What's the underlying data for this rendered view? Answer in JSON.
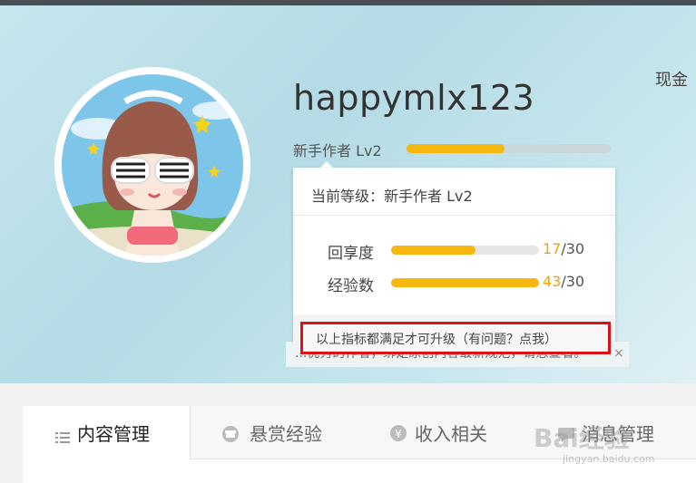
{
  "header": {
    "username": "happymlx123",
    "level_label": "新手作者 Lv2",
    "level_progress": 0.48,
    "cash_label": "现金"
  },
  "level_popup": {
    "title": "当前等级：新手作者 Lv2",
    "metrics": [
      {
        "label": "回享度",
        "current": "17",
        "max": "/30",
        "progress": 0.57
      },
      {
        "label": "经验数",
        "current": "43",
        "max": "/30",
        "progress": 1.0
      }
    ],
    "note": "以上指标都满足才可升级（有问题？点我）"
  },
  "notice": {
    "text": "...优秀的作者，绑定原创内容最新规范，请悉查看。",
    "close": "×"
  },
  "tabs": [
    {
      "label": "内容管理",
      "icon": "list-icon",
      "active": true
    },
    {
      "label": "悬赏经验",
      "icon": "reward-icon",
      "active": false
    },
    {
      "label": "收入相关",
      "icon": "yen-icon",
      "active": false
    },
    {
      "label": "消息管理",
      "icon": "message-icon",
      "active": false
    }
  ],
  "watermark": {
    "text": "Bai经验",
    "sub": "jingyan.baidu.com"
  },
  "colors": {
    "accent": "#f5b710",
    "highlight": "#d8141a",
    "header_bg": "#c7e6ee"
  }
}
